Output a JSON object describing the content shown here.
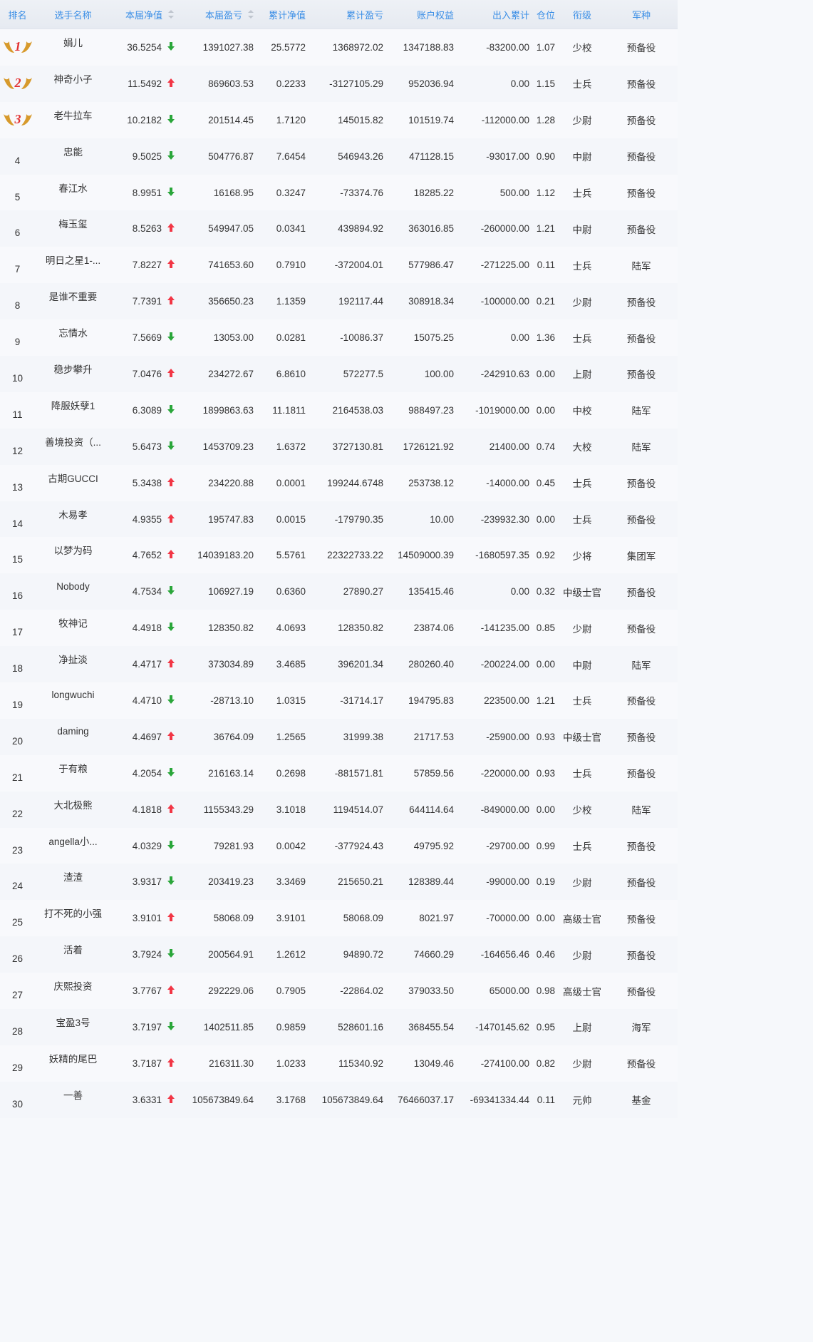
{
  "headers": [
    "排名",
    "选手名称",
    "本届净值",
    "本届盈亏",
    "累计净值",
    "累计盈亏",
    "账户权益",
    "出入累计",
    "仓位",
    "衔级",
    "军种"
  ],
  "colors": {
    "up": "#f23645",
    "down": "#2aa63a",
    "header": "#3a8ee6",
    "medal": "#d79a2c",
    "medalNum": "#e23030"
  },
  "rows": [
    {
      "rank": "1",
      "medal": true,
      "name": "娟儿",
      "nav": "36.5254",
      "dir": "down",
      "pnl": "1391027.38",
      "cnav": "25.5772",
      "cpnl": "1368972.02",
      "equity": "1347188.83",
      "flow": "-83200.00",
      "pos": "1.07",
      "title": "少校",
      "branch": "预备役"
    },
    {
      "rank": "2",
      "medal": true,
      "name": "神奇小子",
      "nav": "11.5492",
      "dir": "up",
      "pnl": "869603.53",
      "cnav": "0.2233",
      "cpnl": "-3127105.29",
      "equity": "952036.94",
      "flow": "0.00",
      "pos": "1.15",
      "title": "士兵",
      "branch": "预备役"
    },
    {
      "rank": "3",
      "medal": true,
      "name": "老牛拉车",
      "nav": "10.2182",
      "dir": "down",
      "pnl": "201514.45",
      "cnav": "1.7120",
      "cpnl": "145015.82",
      "equity": "101519.74",
      "flow": "-112000.00",
      "pos": "1.28",
      "title": "少尉",
      "branch": "预备役"
    },
    {
      "rank": "4",
      "name": "忠能",
      "nav": "9.5025",
      "dir": "down",
      "pnl": "504776.87",
      "cnav": "7.6454",
      "cpnl": "546943.26",
      "equity": "471128.15",
      "flow": "-93017.00",
      "pos": "0.90",
      "title": "中尉",
      "branch": "预备役"
    },
    {
      "rank": "5",
      "name": "春江水",
      "nav": "8.9951",
      "dir": "down",
      "pnl": "16168.95",
      "cnav": "0.3247",
      "cpnl": "-73374.76",
      "equity": "18285.22",
      "flow": "500.00",
      "pos": "1.12",
      "title": "士兵",
      "branch": "预备役"
    },
    {
      "rank": "6",
      "name": "梅玉玺",
      "nav": "8.5263",
      "dir": "up",
      "pnl": "549947.05",
      "cnav": "0.0341",
      "cpnl": "439894.92",
      "equity": "363016.85",
      "flow": "-260000.00",
      "pos": "1.21",
      "title": "中尉",
      "branch": "预备役"
    },
    {
      "rank": "7",
      "name": "明日之星1-...",
      "nav": "7.8227",
      "dir": "up",
      "pnl": "741653.60",
      "cnav": "0.7910",
      "cpnl": "-372004.01",
      "equity": "577986.47",
      "flow": "-271225.00",
      "pos": "0.11",
      "title": "士兵",
      "branch": "陆军"
    },
    {
      "rank": "8",
      "name": "是谁不重要",
      "nav": "7.7391",
      "dir": "up",
      "pnl": "356650.23",
      "cnav": "1.1359",
      "cpnl": "192117.44",
      "equity": "308918.34",
      "flow": "-100000.00",
      "pos": "0.21",
      "title": "少尉",
      "branch": "预备役"
    },
    {
      "rank": "9",
      "name": "忘情水",
      "nav": "7.5669",
      "dir": "down",
      "pnl": "13053.00",
      "cnav": "0.0281",
      "cpnl": "-10086.37",
      "equity": "15075.25",
      "flow": "0.00",
      "pos": "1.36",
      "title": "士兵",
      "branch": "预备役"
    },
    {
      "rank": "10",
      "name": "稳步攀升",
      "nav": "7.0476",
      "dir": "up",
      "pnl": "234272.67",
      "cnav": "6.8610",
      "cpnl": "572277.5",
      "equity": "100.00",
      "flow": "-242910.63",
      "pos": "0.00",
      "title": "上尉",
      "branch": "预备役"
    },
    {
      "rank": "11",
      "name": "降服妖孽1",
      "nav": "6.3089",
      "dir": "down",
      "pnl": "1899863.63",
      "cnav": "11.1811",
      "cpnl": "2164538.03",
      "equity": "988497.23",
      "flow": "-1019000.00",
      "pos": "0.00",
      "title": "中校",
      "branch": "陆军"
    },
    {
      "rank": "12",
      "name": "善境投资（...",
      "nav": "5.6473",
      "dir": "down",
      "pnl": "1453709.23",
      "cnav": "1.6372",
      "cpnl": "3727130.81",
      "equity": "1726121.92",
      "flow": "21400.00",
      "pos": "0.74",
      "title": "大校",
      "branch": "陆军"
    },
    {
      "rank": "13",
      "name": "古期GUCCI",
      "nav": "5.3438",
      "dir": "up",
      "pnl": "234220.88",
      "cnav": "0.0001",
      "cpnl": "199244.6748",
      "equity": "253738.12",
      "flow": "-14000.00",
      "pos": "0.45",
      "title": "士兵",
      "branch": "预备役"
    },
    {
      "rank": "14",
      "name": "木易孝",
      "nav": "4.9355",
      "dir": "up",
      "pnl": "195747.83",
      "cnav": "0.0015",
      "cpnl": "-179790.35",
      "equity": "10.00",
      "flow": "-239932.30",
      "pos": "0.00",
      "title": "士兵",
      "branch": "预备役"
    },
    {
      "rank": "15",
      "name": "以梦为码",
      "nav": "4.7652",
      "dir": "up",
      "pnl": "14039183.20",
      "cnav": "5.5761",
      "cpnl": "22322733.22",
      "equity": "14509000.39",
      "flow": "-1680597.35",
      "pos": "0.92",
      "title": "少将",
      "branch": "集团军"
    },
    {
      "rank": "16",
      "name": "Nobody",
      "nav": "4.7534",
      "dir": "down",
      "pnl": "106927.19",
      "cnav": "0.6360",
      "cpnl": "27890.27",
      "equity": "135415.46",
      "flow": "0.00",
      "pos": "0.32",
      "title": "中级士官",
      "branch": "预备役"
    },
    {
      "rank": "17",
      "name": "牧神记",
      "nav": "4.4918",
      "dir": "down",
      "pnl": "128350.82",
      "cnav": "4.0693",
      "cpnl": "128350.82",
      "equity": "23874.06",
      "flow": "-141235.00",
      "pos": "0.85",
      "title": "少尉",
      "branch": "预备役"
    },
    {
      "rank": "18",
      "name": "净扯淡",
      "nav": "4.4717",
      "dir": "up",
      "pnl": "373034.89",
      "cnav": "3.4685",
      "cpnl": "396201.34",
      "equity": "280260.40",
      "flow": "-200224.00",
      "pos": "0.00",
      "title": "中尉",
      "branch": "陆军"
    },
    {
      "rank": "19",
      "name": "longwuchi",
      "nav": "4.4710",
      "dir": "down",
      "pnl": "-28713.10",
      "cnav": "1.0315",
      "cpnl": "-31714.17",
      "equity": "194795.83",
      "flow": "223500.00",
      "pos": "1.21",
      "title": "士兵",
      "branch": "预备役"
    },
    {
      "rank": "20",
      "name": "daming",
      "nav": "4.4697",
      "dir": "up",
      "pnl": "36764.09",
      "cnav": "1.2565",
      "cpnl": "31999.38",
      "equity": "21717.53",
      "flow": "-25900.00",
      "pos": "0.93",
      "title": "中级士官",
      "branch": "预备役"
    },
    {
      "rank": "21",
      "name": "于有粮",
      "nav": "4.2054",
      "dir": "down",
      "pnl": "216163.14",
      "cnav": "0.2698",
      "cpnl": "-881571.81",
      "equity": "57859.56",
      "flow": "-220000.00",
      "pos": "0.93",
      "title": "士兵",
      "branch": "预备役"
    },
    {
      "rank": "22",
      "name": "大北极熊",
      "nav": "4.1818",
      "dir": "up",
      "pnl": "1155343.29",
      "cnav": "3.1018",
      "cpnl": "1194514.07",
      "equity": "644114.64",
      "flow": "-849000.00",
      "pos": "0.00",
      "title": "少校",
      "branch": "陆军"
    },
    {
      "rank": "23",
      "name": "angella小...",
      "nav": "4.0329",
      "dir": "down",
      "pnl": "79281.93",
      "cnav": "0.0042",
      "cpnl": "-377924.43",
      "equity": "49795.92",
      "flow": "-29700.00",
      "pos": "0.99",
      "title": "士兵",
      "branch": "预备役"
    },
    {
      "rank": "24",
      "name": "渣渣",
      "nav": "3.9317",
      "dir": "down",
      "pnl": "203419.23",
      "cnav": "3.3469",
      "cpnl": "215650.21",
      "equity": "128389.44",
      "flow": "-99000.00",
      "pos": "0.19",
      "title": "少尉",
      "branch": "预备役"
    },
    {
      "rank": "25",
      "name": "打不死的小强",
      "nav": "3.9101",
      "dir": "up",
      "pnl": "58068.09",
      "cnav": "3.9101",
      "cpnl": "58068.09",
      "equity": "8021.97",
      "flow": "-70000.00",
      "pos": "0.00",
      "title": "高级士官",
      "branch": "预备役"
    },
    {
      "rank": "26",
      "name": "活着",
      "nav": "3.7924",
      "dir": "down",
      "pnl": "200564.91",
      "cnav": "1.2612",
      "cpnl": "94890.72",
      "equity": "74660.29",
      "flow": "-164656.46",
      "pos": "0.46",
      "title": "少尉",
      "branch": "预备役"
    },
    {
      "rank": "27",
      "name": "庆熙投资",
      "nav": "3.7767",
      "dir": "up",
      "pnl": "292229.06",
      "cnav": "0.7905",
      "cpnl": "-22864.02",
      "equity": "379033.50",
      "flow": "65000.00",
      "pos": "0.98",
      "title": "高级士官",
      "branch": "预备役"
    },
    {
      "rank": "28",
      "name": "宝盈3号",
      "nav": "3.7197",
      "dir": "down",
      "pnl": "1402511.85",
      "cnav": "0.9859",
      "cpnl": "528601.16",
      "equity": "368455.54",
      "flow": "-1470145.62",
      "pos": "0.95",
      "title": "上尉",
      "branch": "海军"
    },
    {
      "rank": "29",
      "name": "妖精的尾巴",
      "nav": "3.7187",
      "dir": "up",
      "pnl": "216311.30",
      "cnav": "1.0233",
      "cpnl": "115340.92",
      "equity": "13049.46",
      "flow": "-274100.00",
      "pos": "0.82",
      "title": "少尉",
      "branch": "预备役"
    },
    {
      "rank": "30",
      "name": "一善",
      "nav": "3.6331",
      "dir": "up",
      "pnl": "105673849.64",
      "cnav": "3.1768",
      "cpnl": "105673849.64",
      "equity": "76466037.17",
      "flow": "-69341334.44",
      "pos": "0.11",
      "title": "元帅",
      "branch": "基金"
    }
  ]
}
